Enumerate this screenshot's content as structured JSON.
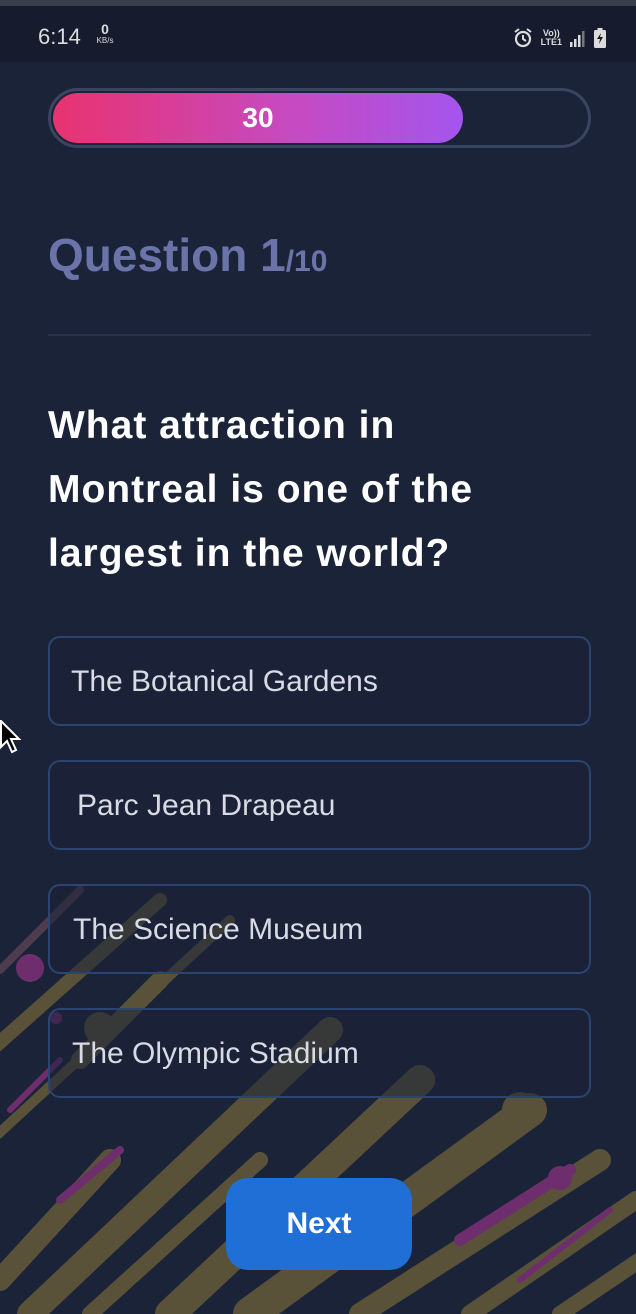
{
  "status_bar": {
    "time": "6:14",
    "net_speed_value": "0",
    "net_speed_unit": "KB/s",
    "volte_line1": "Vo))",
    "volte_line2": "LTE1",
    "icons": [
      "alarm-icon",
      "signal-icon",
      "battery-charging-icon"
    ]
  },
  "timer": {
    "value": "30",
    "progress_fraction": 0.77,
    "gradient_colors": [
      "#e8336f",
      "#a455ee"
    ]
  },
  "quiz": {
    "question_label": "Question 1",
    "question_total": "/10",
    "question_text": "What attraction in Montreal is one of the largest in the world?",
    "options": [
      "The Botanical Gardens",
      "Parc Jean Drapeau",
      "The Science Museum",
      "The Olympic Stadium"
    ],
    "next_label": "Next"
  },
  "colors": {
    "background": "#1b2339",
    "accent_button": "#1f6fd6",
    "header_text": "#6b74a8",
    "option_border": "#2b4470"
  }
}
